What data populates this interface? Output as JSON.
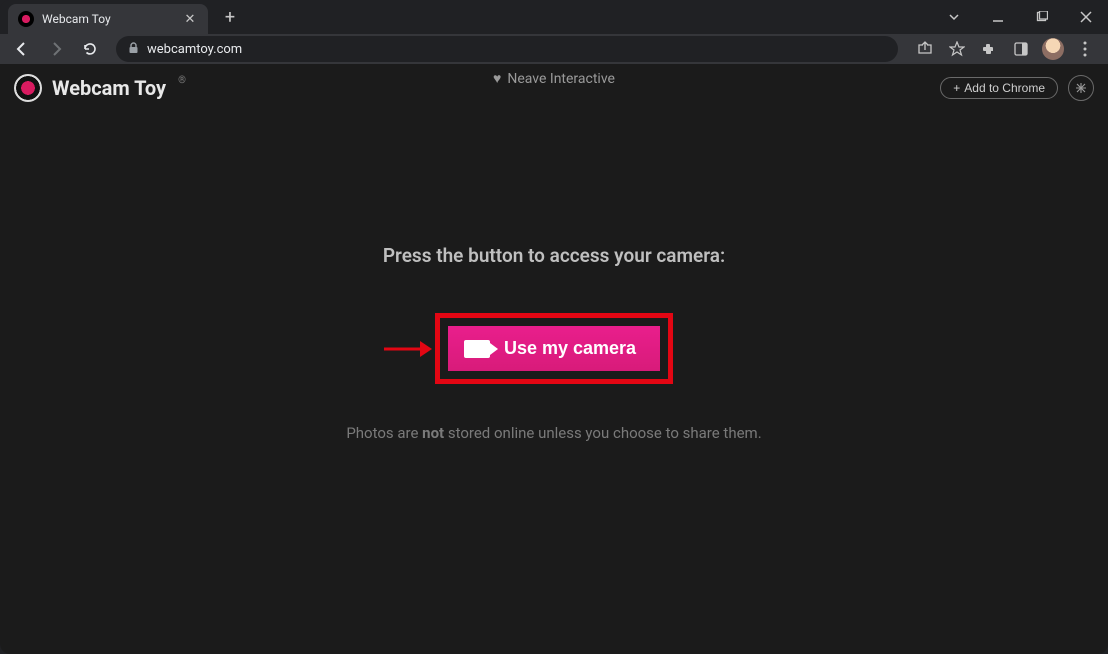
{
  "browser": {
    "tab_title": "Webcam Toy",
    "url": "webcamtoy.com"
  },
  "app": {
    "brand_name": "Webcam Toy",
    "brand_trademark": "®",
    "header_tagline": "Neave Interactive",
    "add_to_chrome_label": "Add to Chrome",
    "add_to_chrome_plus": "+"
  },
  "main": {
    "prompt_text": "Press the button to access your camera:",
    "cta_label": "Use my camera",
    "footnote_prefix": "Photos are ",
    "footnote_bold": "not",
    "footnote_suffix": " stored online unless you choose to share them."
  },
  "colors": {
    "highlight_box": "#e30613",
    "cta_bg": "#e91e8c"
  }
}
